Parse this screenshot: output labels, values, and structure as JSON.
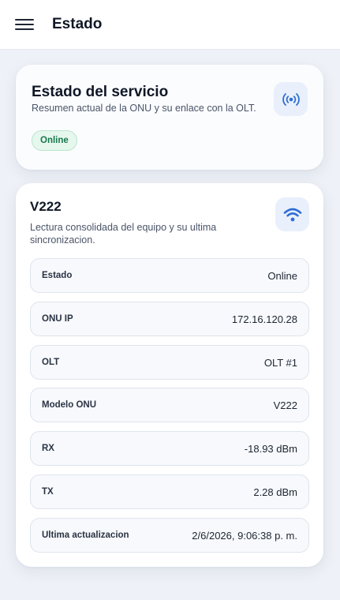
{
  "header": {
    "title": "Estado"
  },
  "service": {
    "title": "Estado del servicio",
    "subtitle": "Resumen actual de la ONU y su enlace con la OLT.",
    "status_badge": "Online",
    "icon": "broadcast-icon"
  },
  "device": {
    "title": "V222",
    "subtitle": "Lectura consolidada del equipo y su ultima sincronizacion.",
    "icon": "wifi-icon",
    "rows": [
      {
        "label": "Estado",
        "value": "Online"
      },
      {
        "label": "ONU IP",
        "value": "172.16.120.28"
      },
      {
        "label": "OLT",
        "value": "OLT #1"
      },
      {
        "label": "Modelo ONU",
        "value": "V222"
      },
      {
        "label": "RX",
        "value": "-18.93 dBm"
      },
      {
        "label": "TX",
        "value": "2.28 dBm"
      },
      {
        "label": "Ultima actualizacion",
        "value": "2/6/2026, 9:06:38 p. m."
      }
    ]
  },
  "colors": {
    "accent": "#2f6fd6",
    "online": "#17774a",
    "background": "#eef1f7"
  }
}
